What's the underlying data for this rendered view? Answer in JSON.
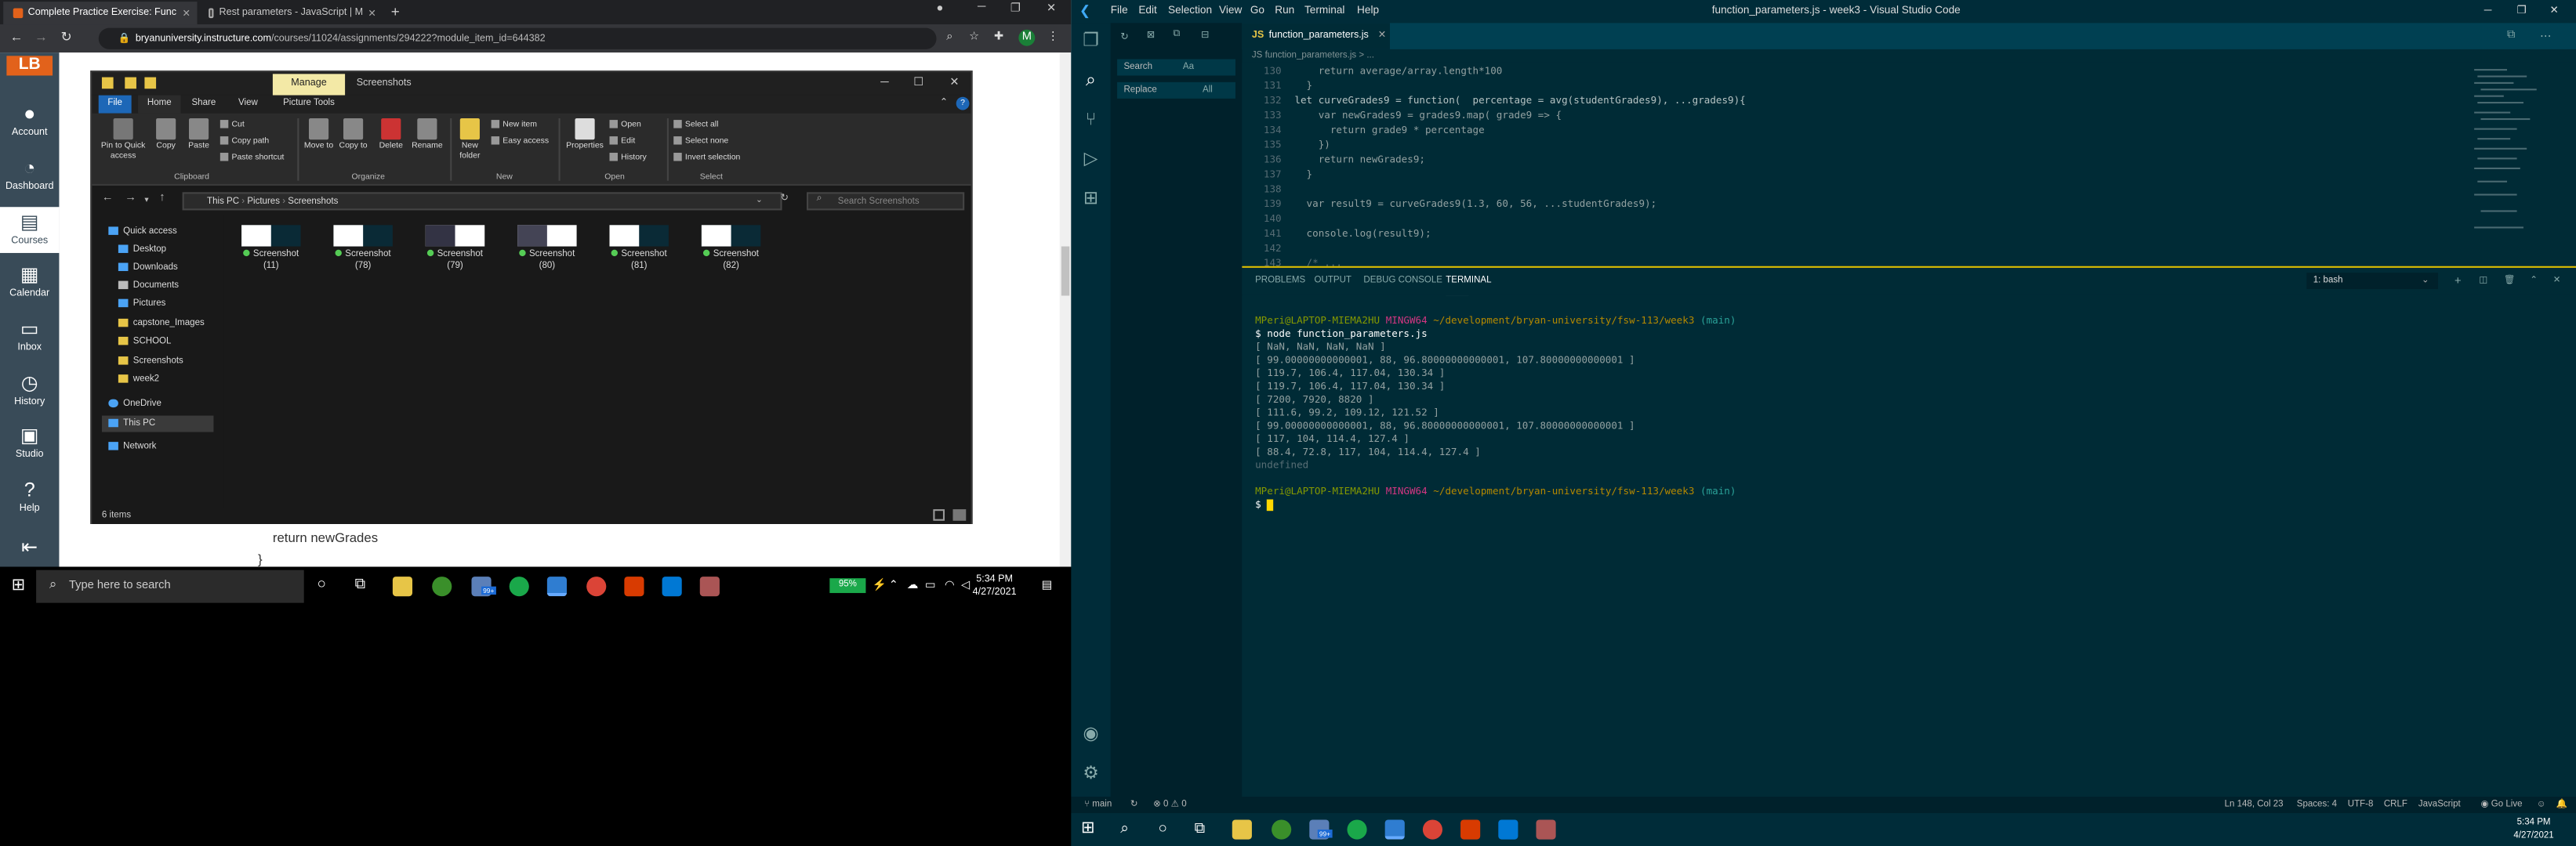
{
  "browser": {
    "tabs": [
      {
        "label": "Complete Practice Exercise: Func"
      },
      {
        "label": "Rest parameters - JavaScript | M"
      }
    ],
    "url_host": "bryanuniversity.instructure.com",
    "url_path": "/courses/11024/assignments/294222?module_item_id=644382",
    "profile_initial": "M"
  },
  "canvas": {
    "logo": "LB",
    "nav": [
      {
        "label": "Account",
        "icon": "account-icon"
      },
      {
        "label": "Dashboard",
        "icon": "dashboard-icon"
      },
      {
        "label": "Courses",
        "icon": "courses-icon"
      },
      {
        "label": "Calendar",
        "icon": "calendar-icon"
      },
      {
        "label": "Inbox",
        "icon": "inbox-icon"
      },
      {
        "label": "History",
        "icon": "history-icon"
      },
      {
        "label": "Studio",
        "icon": "studio-icon"
      },
      {
        "label": "Help",
        "icon": "help-icon"
      }
    ],
    "code_line1": "return newGrades",
    "code_line2": "}"
  },
  "explorer": {
    "manage_tab": "Manage",
    "title": "Screenshots",
    "ribbon_tabs": [
      "File",
      "Home",
      "Share",
      "View",
      "Picture Tools"
    ],
    "ribbon_big": [
      "Pin to Quick access",
      "Copy",
      "Paste",
      "Move to",
      "Copy to",
      "Delete",
      "Rename",
      "New folder",
      "Properties"
    ],
    "ribbon_small": {
      "cut": "Cut",
      "copy_path": "Copy path",
      "paste_shortcut": "Paste shortcut",
      "new_item": "New item",
      "easy_access": "Easy access",
      "open": "Open",
      "edit": "Edit",
      "history": "History",
      "select_all": "Select all",
      "select_none": "Select none",
      "invert_selection": "Invert selection"
    },
    "groups": [
      "Clipboard",
      "Organize",
      "New",
      "Open",
      "Select"
    ],
    "path": [
      "This PC",
      "Pictures",
      "Screenshots"
    ],
    "search_placeholder": "Search Screenshots",
    "nav": [
      {
        "label": "Quick access"
      },
      {
        "label": "Desktop"
      },
      {
        "label": "Downloads"
      },
      {
        "label": "Documents"
      },
      {
        "label": "Pictures"
      },
      {
        "label": "capstone_Images"
      },
      {
        "label": "SCHOOL"
      },
      {
        "label": "Screenshots"
      },
      {
        "label": "week2"
      },
      {
        "label": "OneDrive"
      },
      {
        "label": "This PC"
      },
      {
        "label": "Network"
      }
    ],
    "files": [
      {
        "name": "Screenshot",
        "num": "(11)"
      },
      {
        "name": "Screenshot",
        "num": "(78)"
      },
      {
        "name": "Screenshot",
        "num": "(79)"
      },
      {
        "name": "Screenshot",
        "num": "(80)"
      },
      {
        "name": "Screenshot",
        "num": "(81)"
      },
      {
        "name": "Screenshot",
        "num": "(82)"
      }
    ],
    "status": "6 items"
  },
  "taskbar": {
    "search_placeholder": "Type here to search",
    "battery": "95%",
    "time": "5:34 PM",
    "date": "4/27/2021",
    "badge": "99+"
  },
  "vscode": {
    "menu": [
      "File",
      "Edit",
      "Selection",
      "View",
      "Go",
      "Run",
      "Terminal",
      "Help"
    ],
    "title": "function_parameters.js - week3 - Visual Studio Code",
    "tab": "function_parameters.js",
    "breadcrumb": "JS  function_parameters.js  > ...",
    "search_label": "Search",
    "search_opts": "Aa",
    "replace_label": "Replace",
    "replace_all": "All",
    "code": [
      {
        "n": "130",
        "t": "    return average/array.length*100"
      },
      {
        "n": "131",
        "t": "  }"
      },
      {
        "n": "132",
        "t": "let curveGrades9 = function(  percentage = avg(studentGrades9), ...grades9){"
      },
      {
        "n": "133",
        "t": "    var newGrades9 = grades9.map( grade9 => {"
      },
      {
        "n": "134",
        "t": "      return grade9 * percentage"
      },
      {
        "n": "135",
        "t": "    })"
      },
      {
        "n": "136",
        "t": "    return newGrades9;"
      },
      {
        "n": "137",
        "t": "  }"
      },
      {
        "n": "138",
        "t": ""
      },
      {
        "n": "139",
        "t": "  var result9 = curveGrades9(1.3, 60, 56, ...studentGrades9);"
      },
      {
        "n": "140",
        "t": ""
      },
      {
        "n": "141",
        "t": "  console.log(result9);"
      },
      {
        "n": "142",
        "t": ""
      },
      {
        "n": "143",
        "t": "  /* ..."
      }
    ],
    "panel_tabs": [
      "PROBLEMS",
      "OUTPUT",
      "DEBUG CONSOLE",
      "TERMINAL"
    ],
    "terminal_select": "1: bash",
    "terminal": {
      "prompt_user": "MPeri@LAPTOP-MIEMA2HU",
      "prompt_shell": "MINGW64",
      "prompt_path": "~/development/bryan-university/fsw-113/week3",
      "prompt_branch": "(main)",
      "command": "$ node function_parameters.js",
      "output": [
        "[ NaN, NaN, NaN, NaN ]",
        "[ 99.00000000000001, 88, 96.80000000000001, 107.80000000000001 ]",
        "[ 119.7, 106.4, 117.04, 130.34 ]",
        "[ 119.7, 106.4, 117.04, 130.34 ]",
        "[ 7200, 7920, 8820 ]",
        "[ 111.6, 99.2, 109.12, 121.52 ]",
        "[ 99.00000000000001, 88, 96.80000000000001, 107.80000000000001 ]",
        "[ 117, 104, 114.4, 127.4 ]",
        "[ 88.4, 72.8, 117, 104, 114.4, 127.4 ]",
        "undefined"
      ],
      "prompt2": "$"
    },
    "status": {
      "branch": "main",
      "problems": "⊗ 0 ⚠ 0",
      "position": "Ln 148, Col 23",
      "spaces": "Spaces: 4",
      "encoding": "UTF-8",
      "eol": "CRLF",
      "language": "JavaScript",
      "golive": "Go Live"
    },
    "time": "5:34 PM",
    "date": "4/27/2021"
  }
}
